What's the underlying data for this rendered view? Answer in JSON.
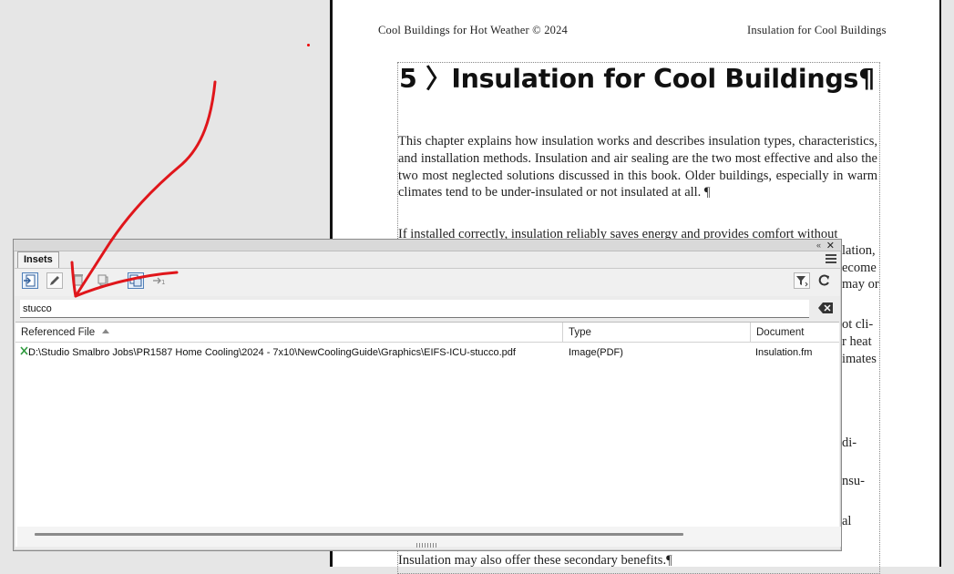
{
  "document": {
    "header_left": "Cool Buildings for Hot Weather © 2024",
    "header_right": "Insulation for Cool Buildings",
    "chapter_title": "5 〉Insulation for Cool Buildings¶",
    "paragraph1": "This chapter explains how insulation works and describes insulation types, characteristics, and installation methods. Insulation and air sealing are the two most effective and also the two most neglected solutions discussed in this book. Older buildings, especially in warm climates tend to be under-insulated or not insulated at all. ¶",
    "paragraph2_line1": "If installed correctly, insulation reliably saves energy and provides comfort without",
    "frag_lation": "lation,",
    "frag_ecome": "ecome",
    "frag_may_or": "may or",
    "frag_ot_cli": "ot cli-",
    "frag_r_heat": "r heat",
    "frag_imates": "imates",
    "frag_di": "di-",
    "frag_nsu": "nsu-",
    "frag_al": "al",
    "last_line": "Insulation may also offer these secondary benefits.¶"
  },
  "panel": {
    "tab_label": "Insets",
    "collapse_label": "«",
    "close_label": "✕",
    "search_value": "stucco",
    "search_placeholder": "",
    "toolbar_icons": [
      "insert-inset-icon",
      "edit-inset-icon",
      "delete-inset-icon",
      "delete-all-insets-icon",
      "copy-inset-icon",
      "go-to-inset-icon",
      "filter-icon",
      "refresh-icon"
    ],
    "columns": {
      "file": "Referenced File",
      "type": "Type",
      "document": "Document"
    },
    "rows": [
      {
        "status_icon": "missing-file-icon",
        "file": "D:\\Studio Smalbro Jobs\\PR1587 Home Cooling\\2024 - 7x10\\NewCoolingGuide\\Graphics\\EIFS-ICU-stucco.pdf",
        "type": "Image(PDF)",
        "document": "Insulation.fm"
      }
    ]
  },
  "colors": {
    "annotation": "#e0161b",
    "accent_blue": "#4f7fb8"
  }
}
